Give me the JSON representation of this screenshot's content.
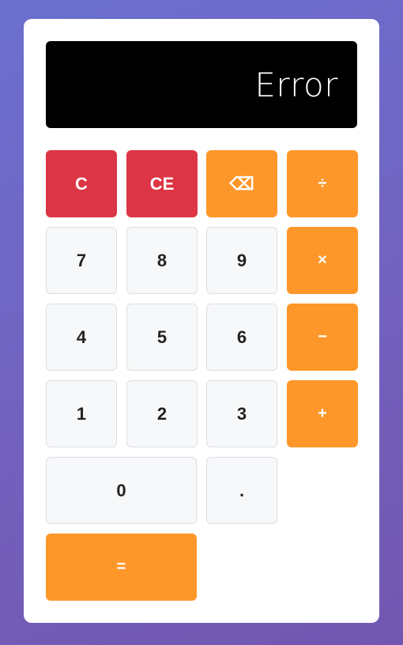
{
  "display": {
    "value": "Error"
  },
  "buttons": {
    "clear": "C",
    "clear_entry": "CE",
    "backspace": "⌫",
    "divide": "÷",
    "seven": "7",
    "eight": "8",
    "nine": "9",
    "multiply": "×",
    "four": "4",
    "five": "5",
    "six": "6",
    "subtract": "−",
    "one": "1",
    "two": "2",
    "three": "3",
    "add": "+",
    "zero": "0",
    "decimal": ".",
    "equals": "="
  },
  "colors": {
    "operator": "#fe972a",
    "clear": "#dc3545",
    "number": "#f7f8f9",
    "display": "#000000"
  }
}
